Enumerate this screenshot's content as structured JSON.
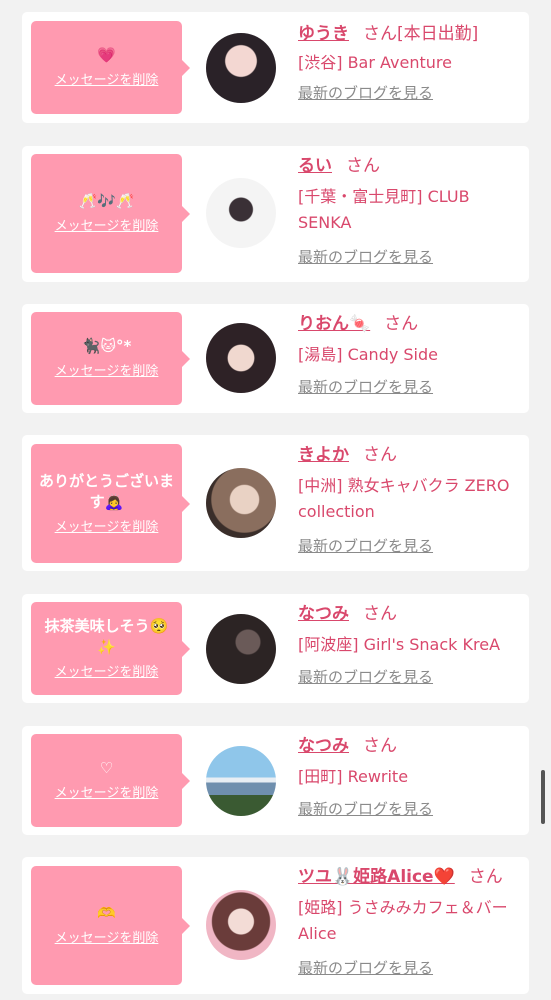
{
  "delete_label": "メッセージを削除",
  "san_label": "さん",
  "blog_label": "最新のブログを見る",
  "colors": {
    "accent": "#d9486c",
    "bubble": "#ff9ab0",
    "background": "#f2f2f2"
  },
  "cards": [
    {
      "message": "💗",
      "name": "ゆうき",
      "status": "[本日出勤]",
      "shop": "[渋谷] Bar Aventure"
    },
    {
      "message": "🥂🎶🥂",
      "name": "るい",
      "status": "",
      "shop": "[千葉・富士見町] CLUB SENKA"
    },
    {
      "message": "🐈‍⬛🐱°*",
      "name": "りおん🍬",
      "status": "",
      "shop": "[湯島] Candy Side"
    },
    {
      "message": "ありがとうございます🙇‍♀️",
      "name": "きよか",
      "status": "",
      "shop": "[中洲] 熟女キャバクラ ZERO collection"
    },
    {
      "message": "抹茶美味しそう🥺✨",
      "name": "なつみ",
      "status": "",
      "shop": "[阿波座] Girl's Snack KreA"
    },
    {
      "message": "♡",
      "name": "なつみ",
      "status": "",
      "shop": "[田町] Rewrite"
    },
    {
      "message": "🫶",
      "name": "ツユ🐰姫路Alice❤️",
      "status": "",
      "shop": "[姫路] うさみみカフェ＆バー　Alice"
    }
  ]
}
